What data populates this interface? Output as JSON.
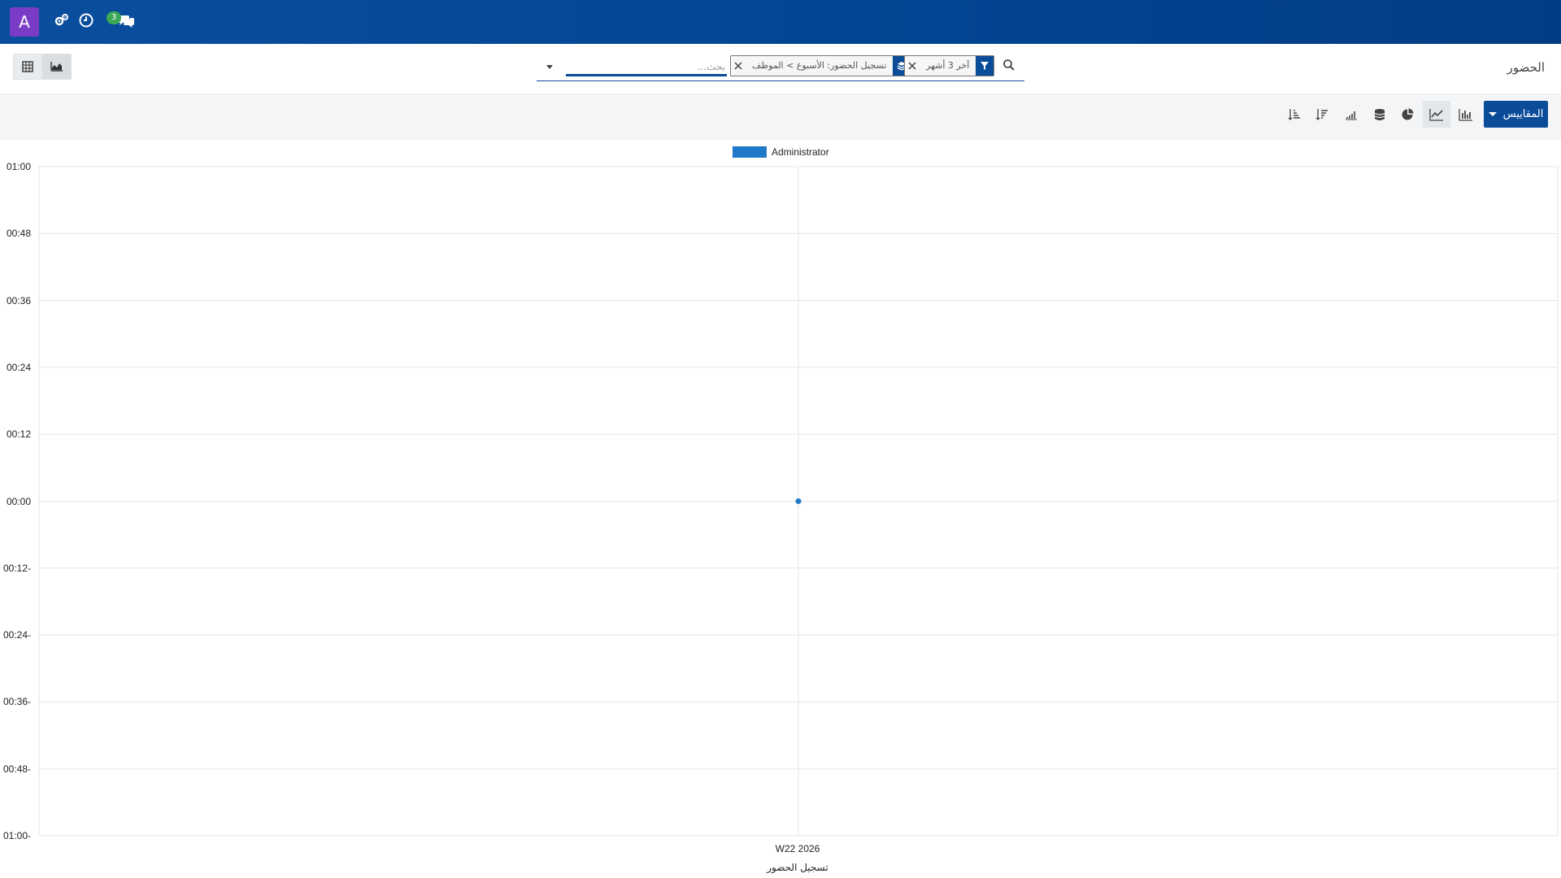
{
  "navbar": {
    "avatar_letter": "A",
    "messages_badge": "3",
    "accent_color": "#024592",
    "avatar_color": "#7a3bc6",
    "icons": [
      "avatar",
      "settings-gears-icon",
      "clock-icon",
      "chat-icon"
    ]
  },
  "control_panel": {
    "breadcrumb": "الحضور",
    "search": {
      "placeholder": "بحث...",
      "facets": [
        {
          "icon": "filter-icon",
          "label": "آخر 3 أشهر"
        },
        {
          "icon": "layers-icon",
          "label": "تسجيل الحضور: الأسبوع > الموظف"
        }
      ]
    },
    "view_buttons": [
      "pivot-view-icon",
      "graph-view-icon"
    ]
  },
  "toolbar": {
    "measures_label": "المقاييس",
    "tools": [
      "bar-chart-icon",
      "line-chart-icon",
      "pie-chart-icon",
      "stacked-icon",
      "cumulative-icon",
      "sort-descending-icon",
      "sort-ascending-icon"
    ],
    "active_tool": "line-chart-icon"
  },
  "chart_data": {
    "type": "line",
    "legend": [
      "Administrator"
    ],
    "legend_position": "top-center",
    "series": [
      {
        "name": "Administrator",
        "color": "#1f78c8",
        "values": [
          0
        ]
      }
    ],
    "categories": [
      "W22 2026"
    ],
    "xlabel": "تسجيل الحضور",
    "ylabel": "",
    "ylim": [
      -60,
      60
    ],
    "ytick_labels": [
      "01:00",
      "00:48",
      "00:36",
      "00:24",
      "00:12",
      "00:00",
      "00:12-",
      "00:24-",
      "00:36-",
      "00:48-",
      "01:00-"
    ],
    "grid": true
  }
}
